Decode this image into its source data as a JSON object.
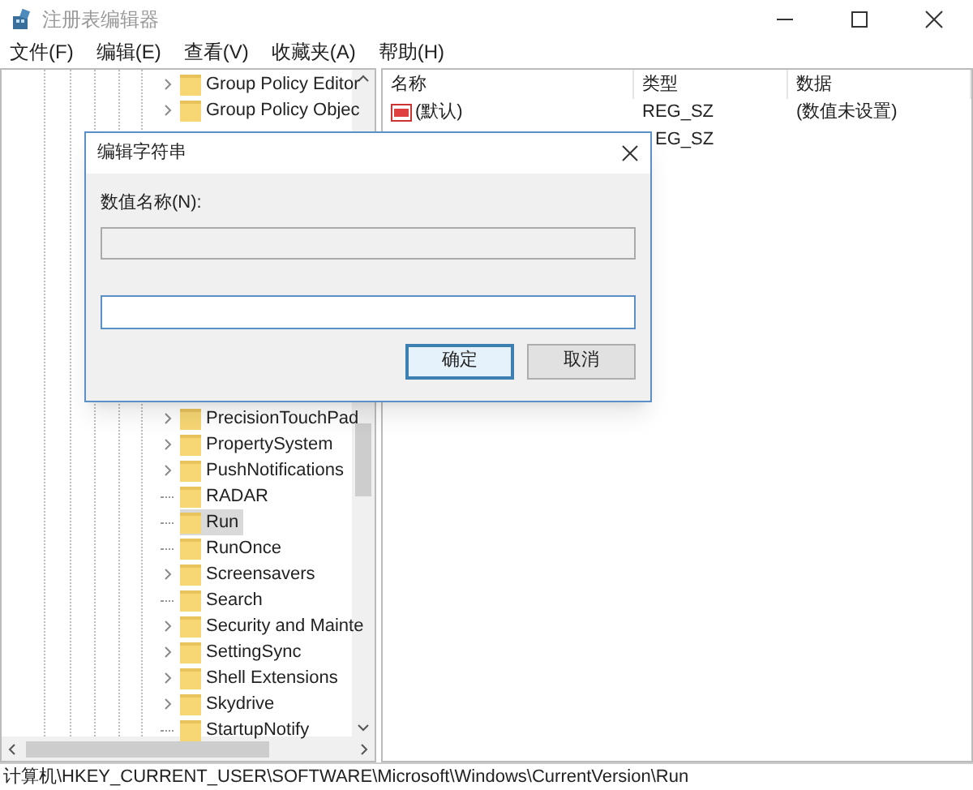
{
  "window": {
    "title": "注册表编辑器"
  },
  "menu": [
    "文件(F)",
    "编辑(E)",
    "查看(V)",
    "收藏夹(A)",
    "帮助(H)"
  ],
  "tree": {
    "items_top": [
      {
        "label": "Group Policy Editor",
        "expandable": true,
        "selected": false
      },
      {
        "label": "Group Policy Objec",
        "expandable": true,
        "selected": false
      }
    ],
    "items": [
      {
        "label": "PrecisionTouchPad",
        "expandable": true,
        "selected": false
      },
      {
        "label": "PropertySystem",
        "expandable": true,
        "selected": false
      },
      {
        "label": "PushNotifications",
        "expandable": true,
        "selected": false
      },
      {
        "label": "RADAR",
        "expandable": false,
        "selected": false
      },
      {
        "label": "Run",
        "expandable": false,
        "selected": true
      },
      {
        "label": "RunOnce",
        "expandable": false,
        "selected": false
      },
      {
        "label": "Screensavers",
        "expandable": true,
        "selected": false
      },
      {
        "label": "Search",
        "expandable": false,
        "selected": false
      },
      {
        "label": "Security and Mainte",
        "expandable": true,
        "selected": false
      },
      {
        "label": "SettingSync",
        "expandable": true,
        "selected": false
      },
      {
        "label": "Shell Extensions",
        "expandable": true,
        "selected": false
      },
      {
        "label": "Skydrive",
        "expandable": true,
        "selected": false
      },
      {
        "label": "StartupNotify",
        "expandable": false,
        "selected": false
      }
    ]
  },
  "list": {
    "columns": [
      "名称",
      "类型",
      "数据"
    ],
    "rows": [
      {
        "name": "(默认)",
        "type": "REG_SZ",
        "data": "(数值未设置)"
      },
      {
        "type": "EG_SZ"
      }
    ]
  },
  "dialog": {
    "title": "编辑字符串",
    "name_label": "数值名称(N):",
    "buttons": [
      {
        "label": "确定",
        "default": true
      },
      {
        "label": "取消",
        "default": false
      }
    ]
  },
  "status_bar": "计算机\\HKEY_CURRENT_USER\\SOFTWARE\\Microsoft\\Windows\\CurrentVersion\\Run"
}
